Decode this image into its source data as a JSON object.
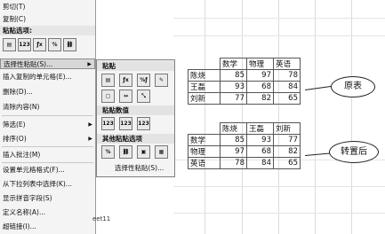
{
  "menu": {
    "items_top": [
      {
        "label": "剪切(T)"
      },
      {
        "label": "复制(C)"
      }
    ],
    "paste_options_header": "粘贴选项:",
    "paste_icons": [
      "paste-icon",
      "values-123-icon",
      "formula-fx-icon",
      "percent-format-icon",
      "link-icon"
    ],
    "items_mid": [
      {
        "label": "选择性粘贴(S)...",
        "selected": true,
        "has_submenu": true
      },
      {
        "label": "插入复制的单元格(E)..."
      },
      {
        "label": "删除(D)..."
      },
      {
        "label": "清除内容(N)"
      }
    ],
    "items_filter": [
      {
        "label": "筛选(E)",
        "has_submenu": true
      },
      {
        "label": "排序(O)",
        "has_submenu": true
      }
    ],
    "items_comment": [
      {
        "label": "插入批注(M)"
      }
    ],
    "items_bottom": [
      {
        "label": "设置单元格格式(F)..."
      },
      {
        "label": "从下拉列表中选择(K)..."
      },
      {
        "label": "显示拼音字段(S)"
      },
      {
        "label": "定义名称(A)..."
      },
      {
        "label": "超链接(I)..."
      }
    ]
  },
  "submenu": {
    "paste_header": "粘贴",
    "paste_icons_row1": [
      "paste-icon",
      "formula-fx-icon",
      "formula-format-icon",
      "keep-source-format-icon"
    ],
    "paste_icons_row2": [
      "no-borders-icon",
      "keep-column-width-icon",
      "transpose-icon"
    ],
    "values_header": "粘贴数值",
    "values_icons": [
      "values-123-icon",
      "values-number-format-icon",
      "values-source-format-icon"
    ],
    "other_header": "其他粘贴选项",
    "other_icons": [
      "formatting-percent-icon",
      "paste-link-icon",
      "picture-icon",
      "linked-picture-icon"
    ],
    "special_label": "选择性粘贴(S)..."
  },
  "sheet_tab": "eet11",
  "table_original": {
    "headers": [
      "",
      "数学",
      "物理",
      "英语"
    ],
    "rows": [
      [
        "陈烧",
        "85",
        "97",
        "78"
      ],
      [
        "王磊",
        "93",
        "68",
        "84"
      ],
      [
        "刘新",
        "77",
        "82",
        "65"
      ]
    ],
    "callout": "原表"
  },
  "table_transposed": {
    "headers": [
      "",
      "陈烧",
      "王磊",
      "刘新"
    ],
    "rows": [
      [
        "数学",
        "85",
        "93",
        "77"
      ],
      [
        "物理",
        "97",
        "68",
        "82"
      ],
      [
        "英语",
        "78",
        "84",
        "65"
      ]
    ],
    "callout": "转置后"
  }
}
